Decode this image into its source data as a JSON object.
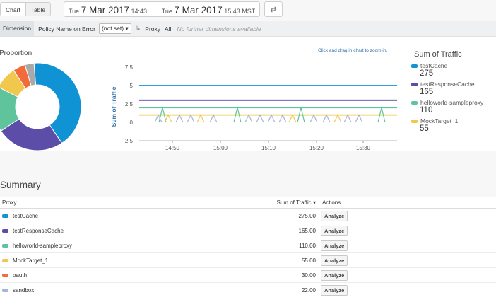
{
  "view_toggle": {
    "chart_label": "Chart",
    "table_label": "Table"
  },
  "date_range": {
    "start_weekday": "Tue",
    "start_date": "7 Mar 2017",
    "start_time": "14:43",
    "separator": "–",
    "end_weekday": "Tue",
    "end_date": "7 Mar 2017",
    "end_time": "15:43 MST"
  },
  "swap_icon": "⇄",
  "dimension_bar": {
    "label": "Dimension",
    "policy_label": "Policy Name on Error",
    "policy_value": "(not set) ▾",
    "proxy_label": "Proxy",
    "all_label": "All",
    "note": "No further dimensions available",
    "arrow_icon": "↳"
  },
  "proportion_title": "Proportion",
  "zoom_hint": "Click and drag in chart to zoom in.",
  "legend_title": "Sum of Traffic",
  "legend": [
    {
      "name": "testCache",
      "value": "275",
      "color": "#0f93d4"
    },
    {
      "name": "testResponseCache",
      "value": "165",
      "color": "#5b4da8"
    },
    {
      "name": "helloworld-sampleproxy",
      "value": "110",
      "color": "#5fc49c"
    },
    {
      "name": "MockTarget_1",
      "value": "55",
      "color": "#f2c74e"
    }
  ],
  "chart_data": {
    "type": "line",
    "ylabel": "Sum of Traffic",
    "y_ticks": [
      "7.5",
      "5",
      "2.5",
      "0",
      "−2.5"
    ],
    "x_ticks": [
      "14:50",
      "15:00",
      "15:10",
      "15:20",
      "15:30"
    ],
    "ylim": [
      -2.5,
      7.5
    ],
    "xlim_minutes": [
      14.5,
      52
    ],
    "series": [
      {
        "name": "testCache",
        "color": "#0f93d4",
        "x": [
          14.5,
          52
        ],
        "values": [
          5,
          5
        ]
      },
      {
        "name": "testResponseCache",
        "color": "#5b4da8",
        "x": [
          14.5,
          52
        ],
        "values": [
          3,
          3
        ]
      },
      {
        "name": "helloworld-sampleproxy",
        "color": "#5fc49c",
        "x": [
          14.5,
          52
        ],
        "values": [
          2,
          2
        ]
      },
      {
        "name": "MockTarget_1",
        "color": "#f2c74e",
        "x": [
          14.5,
          52
        ],
        "values": [
          1,
          1
        ]
      }
    ],
    "pie": {
      "type": "pie",
      "slices": [
        {
          "name": "testCache",
          "value": 275,
          "color": "#0f93d4"
        },
        {
          "name": "testResponseCache",
          "value": 165,
          "color": "#5b4da8"
        },
        {
          "name": "helloworld-sampleproxy",
          "value": 110,
          "color": "#5fc49c"
        },
        {
          "name": "MockTarget_1",
          "value": 55,
          "color": "#f2c74e"
        },
        {
          "name": "oauth",
          "value": 30,
          "color": "#f26b3a"
        },
        {
          "name": "sandbox",
          "value": 22,
          "color": "#a9a9a9"
        }
      ]
    }
  },
  "summary_title": "Summary",
  "table": {
    "headers": {
      "proxy": "Proxy",
      "traffic": "Sum of Traffic ▾",
      "actions": "Actions"
    },
    "rows": [
      {
        "proxy": "testCache",
        "traffic": "275.00",
        "color": "#0f93d4"
      },
      {
        "proxy": "testResponseCache",
        "traffic": "165.00",
        "color": "#5b4da8"
      },
      {
        "proxy": "helloworld-sampleproxy",
        "traffic": "110.00",
        "color": "#5fc49c"
      },
      {
        "proxy": "MockTarget_1",
        "traffic": "55.00",
        "color": "#f2c74e"
      },
      {
        "proxy": "oauth",
        "traffic": "30.00",
        "color": "#f26b3a"
      },
      {
        "proxy": "sandbox",
        "traffic": "22.00",
        "color": "#a6b4d8"
      }
    ],
    "action_label": "Analyze"
  }
}
